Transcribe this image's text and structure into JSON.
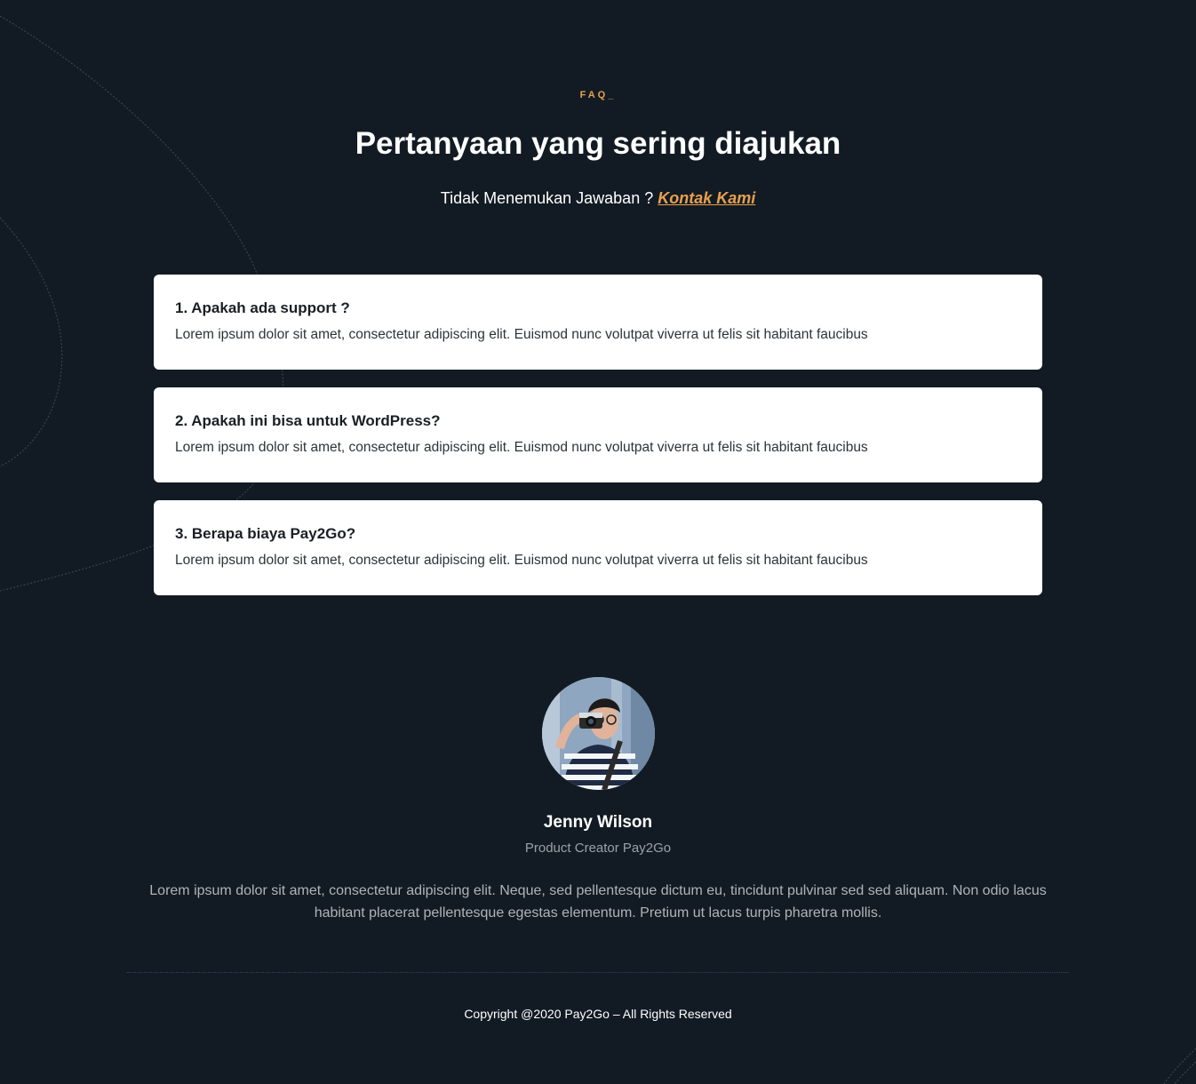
{
  "faq_section": {
    "eyebrow": "FAQ_",
    "title": "Pertanyaan yang sering diajukan",
    "subtitle_text": "Tidak Menemukan Jawaban ? ",
    "contact_link": "Kontak Kami",
    "items": [
      {
        "question": "1. Apakah ada support ?",
        "answer": "Lorem ipsum dolor sit amet, consectetur adipiscing elit. Euismod nunc volutpat viverra ut felis sit habitant faucibus"
      },
      {
        "question": "2. Apakah ini bisa untuk WordPress?",
        "answer": "Lorem ipsum dolor sit amet, consectetur adipiscing elit. Euismod nunc volutpat viverra ut felis sit habitant faucibus"
      },
      {
        "question": "3. Berapa biaya Pay2Go?",
        "answer": "Lorem ipsum dolor sit amet, consectetur adipiscing elit. Euismod nunc volutpat viverra ut felis sit habitant faucibus"
      }
    ]
  },
  "testimonial": {
    "name": "Jenny Wilson",
    "role": "Product Creator Pay2Go",
    "text": "Lorem ipsum dolor sit amet, consectetur adipiscing elit. Neque, sed pellentesque dictum eu, tincidunt pulvinar sed sed aliquam. Non odio lacus habitant placerat pellentesque egestas elementum. Pretium ut lacus turpis pharetra mollis."
  },
  "footer": {
    "copyright": "Copyright @2020 Pay2Go – All Rights Reserved"
  },
  "colors": {
    "background": "#121b23",
    "accent": "#e8a04f",
    "card": "#ffffff"
  }
}
